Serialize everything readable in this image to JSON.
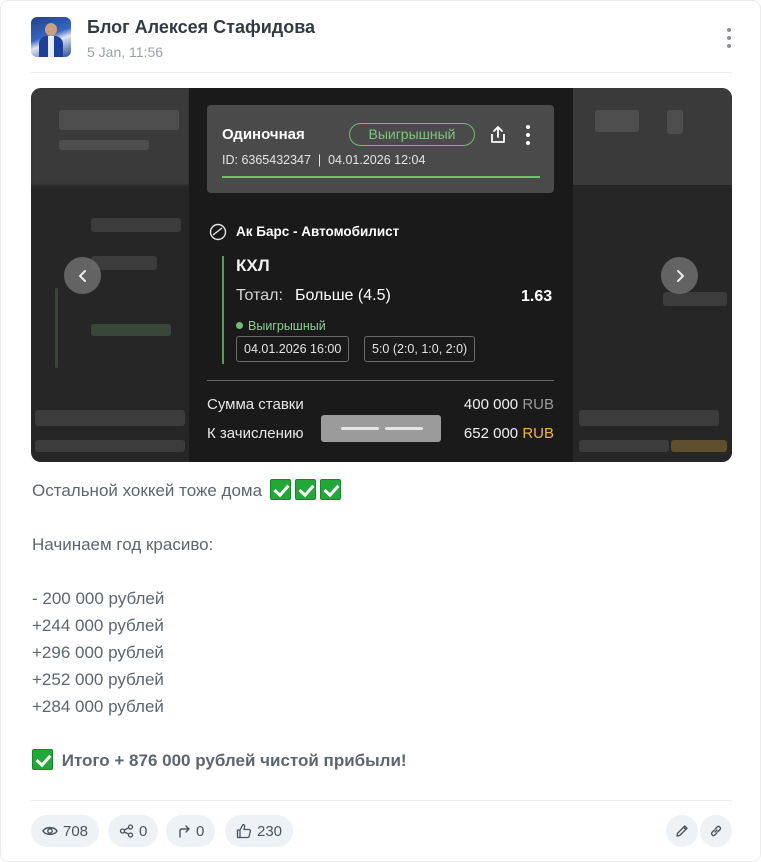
{
  "post": {
    "channel_name": "Блог Алексея Стафидова",
    "time": "5 Jan, 11:56"
  },
  "bet_slip": {
    "type": "Одиночная",
    "status_pill": "Выигрышный",
    "id_line": "ID: 6365432347  |  04.01.2026 12:04",
    "match": "Ак Барс - Автомобилист",
    "league": "КХЛ",
    "outcome_label": "Тотал:",
    "outcome_value": "Больше (4.5)",
    "odds": "1.63",
    "status": "Выигрышный",
    "event_date": "04.01.2026 16:00",
    "score": "5:0 (2:0, 1:0, 2:0)",
    "stake_label": "Сумма ставки",
    "stake_amount": "400 000",
    "payout_label": "К зачислению",
    "payout_amount": "652 000",
    "currency": "RUB"
  },
  "text": {
    "line1": "Остальной хоккей тоже дома",
    "line2": "Начинаем год красиво:",
    "results": [
      "- 200 000 рублей",
      "+244 000 рублей",
      "+296 000 рублей",
      "+252 000 рублей",
      "+284 000 рублей"
    ],
    "total": "Итого + 876 000 рублей чистой прибыли!"
  },
  "stats": {
    "views": "708",
    "shares": "0",
    "forwards": "0",
    "likes": "230"
  },
  "icons": [
    "more-vertical-icon",
    "chevron-left-icon",
    "chevron-right-icon",
    "eye-icon",
    "share-icon",
    "forward-icon",
    "thumbs-up-icon",
    "pencil-icon",
    "link-icon",
    "check-emoji-icon"
  ],
  "colors": {
    "win_green": "#6fbf70",
    "currency_gold": "#f0b443",
    "check_green": "#22a838"
  }
}
